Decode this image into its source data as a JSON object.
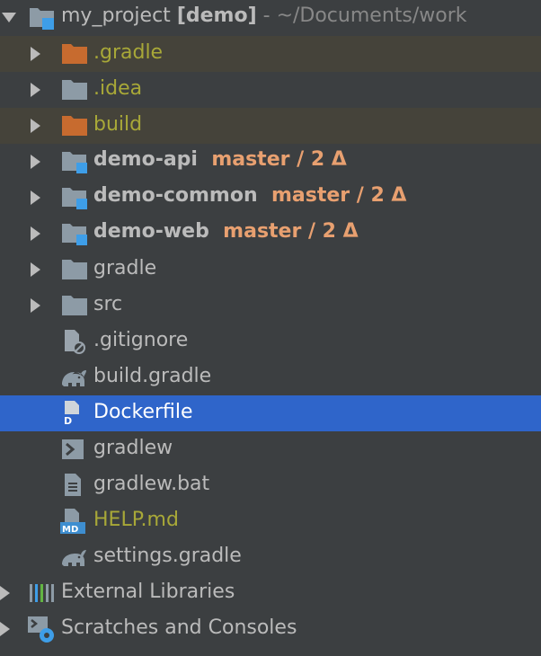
{
  "root": {
    "name": "my_project",
    "tag": "[demo]",
    "path": " - ~/Documents/work"
  },
  "items": {
    "gradle_dir": ".gradle",
    "idea_dir": ".idea",
    "build_dir": "build",
    "demo_api": {
      "name": "demo-api",
      "branch": "master / 2 Δ"
    },
    "demo_common": {
      "name": "demo-common",
      "branch": "master / 2 Δ"
    },
    "demo_web": {
      "name": "demo-web",
      "branch": "master / 2 Δ"
    },
    "gradle": "gradle",
    "src": "src",
    "gitignore": ".gitignore",
    "build_gradle": "build.gradle",
    "dockerfile": "Dockerfile",
    "gradlew": "gradlew",
    "gradlew_bat": "gradlew.bat",
    "help_md": "HELP.md",
    "settings_gradle": "settings.gradle"
  },
  "external_libraries": "External Libraries",
  "scratches": "Scratches and Consoles",
  "icon_text": {
    "dockerfile_letter": "D",
    "md_badge": "MD"
  },
  "colors": {
    "background": "#3c3f41",
    "selection": "#2f65ca",
    "excluded_row": "#45433a",
    "excluded_folder": "#c76b2f",
    "folder": "#8d9ba6",
    "module_badge": "#3e9ee8",
    "vcs_branch": "#e8a070",
    "ignored_text": "#a8a838"
  }
}
